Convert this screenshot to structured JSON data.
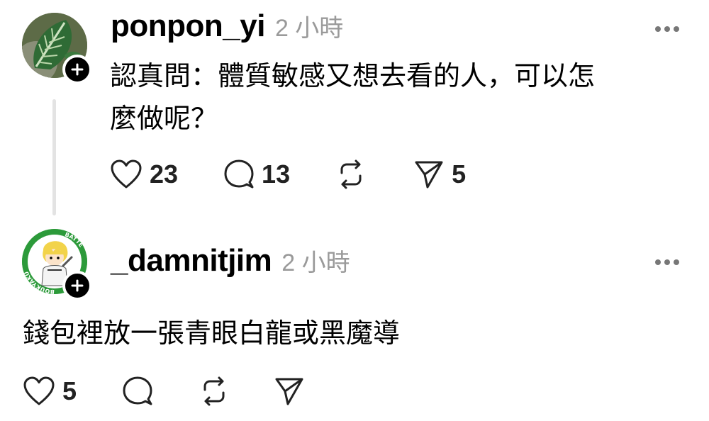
{
  "posts": [
    {
      "username": "ponpon_yi",
      "time": "2 小時",
      "text_lines": [
        "認真問：體質敏感又想去看的人，可以怎",
        "麼做呢？"
      ],
      "likes": "23",
      "replies": "13",
      "reposts": "",
      "shares": "5",
      "avatar_icon": "plant-leaf-avatar"
    },
    {
      "username": "_damnitjim",
      "time": "2 小時",
      "text": "錢包裡放一張青眼白龍或黑魔導",
      "likes": "5",
      "replies": "",
      "reposts": "",
      "shares": "",
      "avatar_icon": "anime-character-avatar",
      "avatar_badge_text": [
        "BOUKYAKU",
        "BATTE"
      ]
    }
  ],
  "colors": {
    "text": "#000000",
    "muted": "#9a9a9a",
    "thread_line": "#e3e3e3",
    "badge_bg": "#000000"
  }
}
